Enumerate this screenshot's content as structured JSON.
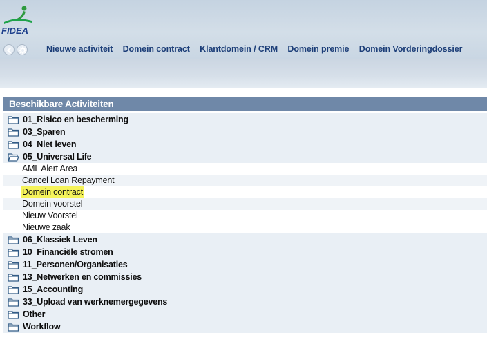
{
  "header": {
    "logo_text": "FIDEA",
    "nav_items": [
      "Nieuwe activiteit",
      "Domein contract",
      "Klantdomein / CRM",
      "Domein premie",
      "Domein Vorderingdossier"
    ]
  },
  "panel": {
    "title": "Beschikbare Activiteiten",
    "folders_top": [
      {
        "label": "01_Risico en bescherming",
        "underline": false
      },
      {
        "label": "03_Sparen",
        "underline": false
      },
      {
        "label": "04_Niet leven",
        "underline": true
      },
      {
        "label": "05_Universal Life",
        "underline": false
      }
    ],
    "leaves": [
      {
        "label": "AML Alert Area",
        "highlighted": false
      },
      {
        "label": "Cancel Loan Repayment",
        "highlighted": false
      },
      {
        "label": "Domein contract",
        "highlighted": true
      },
      {
        "label": "Domein voorstel",
        "highlighted": false
      },
      {
        "label": "Nieuw Voorstel",
        "highlighted": false
      },
      {
        "label": "Nieuwe zaak",
        "highlighted": false
      }
    ],
    "folders_bottom": [
      {
        "label": "06_Klassiek Leven"
      },
      {
        "label": "10_Financiële stromen"
      },
      {
        "label": "11_Personen/Organisaties"
      },
      {
        "label": "13_Netwerken en commissies"
      },
      {
        "label": "15_Accounting"
      },
      {
        "label": "33_Upload van werknemergegevens"
      },
      {
        "label": "Other"
      },
      {
        "label": "Workflow"
      }
    ]
  },
  "colors": {
    "header_bg": "#c9d6e3",
    "panel_header_bg": "#6f88a8",
    "nav_text": "#1c3e78",
    "highlight": "#f5f35a",
    "folder_row_bg": "#e9eff5"
  },
  "icons": {
    "back": "back-arrow-icon",
    "home": "home-gear-icon",
    "folder": "folder-icon"
  }
}
